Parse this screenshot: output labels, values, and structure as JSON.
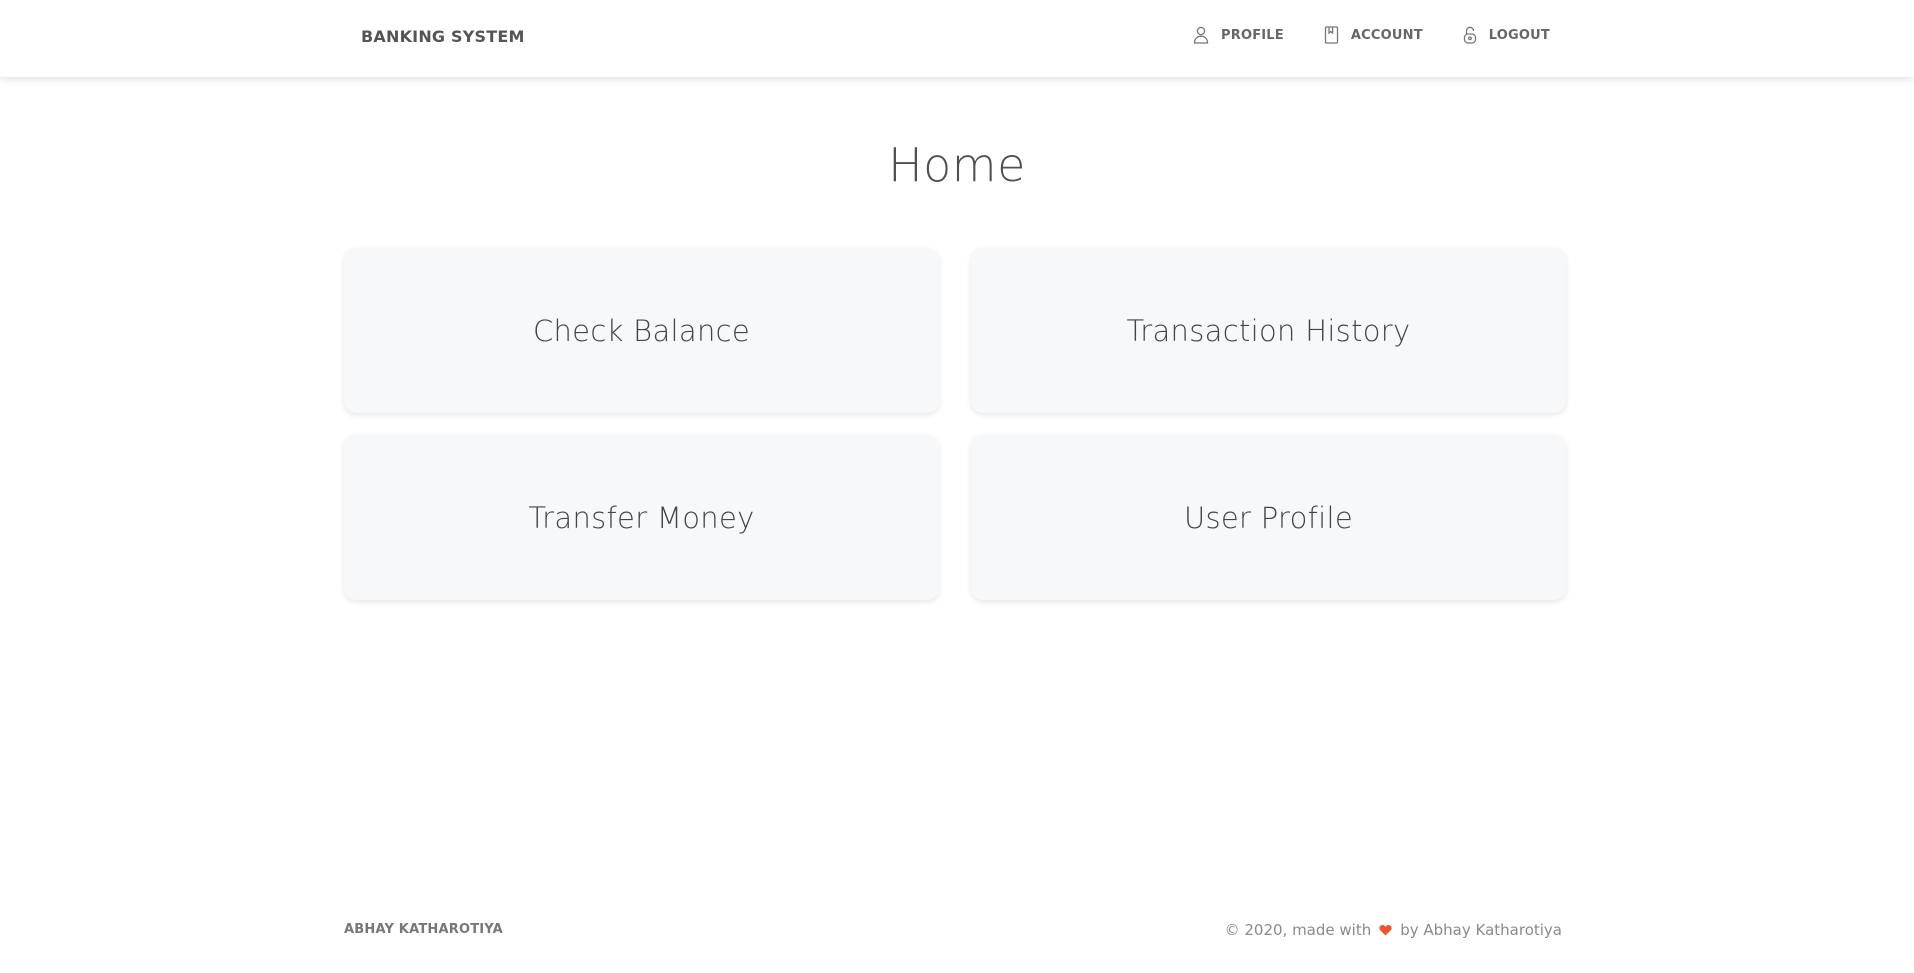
{
  "navbar": {
    "brand": "BANKING SYSTEM",
    "links": [
      {
        "label": "PROFILE",
        "icon": "user-icon"
      },
      {
        "label": "ACCOUNT",
        "icon": "book-icon"
      },
      {
        "label": "LOGOUT",
        "icon": "lock-icon"
      }
    ]
  },
  "main": {
    "title": "Home",
    "cards": [
      {
        "label": "Check Balance"
      },
      {
        "label": "Transaction History"
      },
      {
        "label": "Transfer Money"
      },
      {
        "label": "User Profile"
      }
    ]
  },
  "footer": {
    "left": "ABHAY KATHAROTIYA",
    "right_prefix": "© 2020, made with",
    "heart_icon": "heart-icon",
    "right_suffix": "by Abhay Katharotiya"
  },
  "colors": {
    "heart": "#e8572f",
    "card_background": "#f7f8fa",
    "text": "#4a4a4a"
  }
}
